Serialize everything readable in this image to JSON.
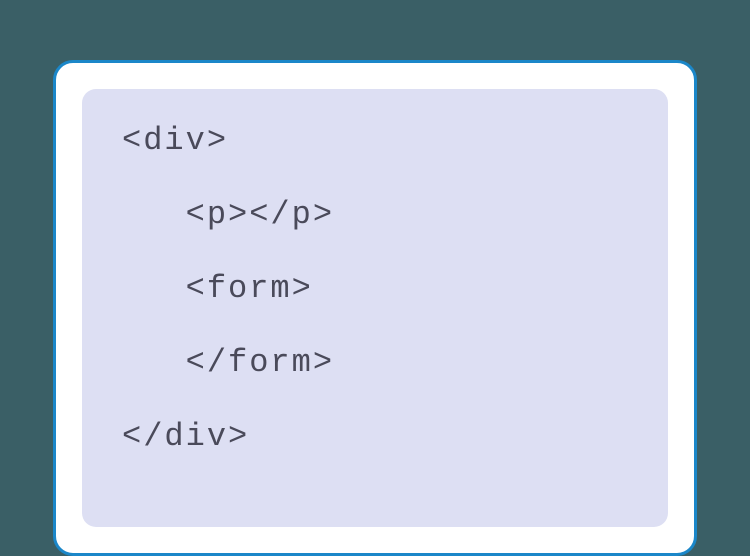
{
  "code": {
    "lines": [
      "<div>",
      "   <p></p>",
      "   <form>",
      "   </form>",
      "</div>"
    ]
  }
}
